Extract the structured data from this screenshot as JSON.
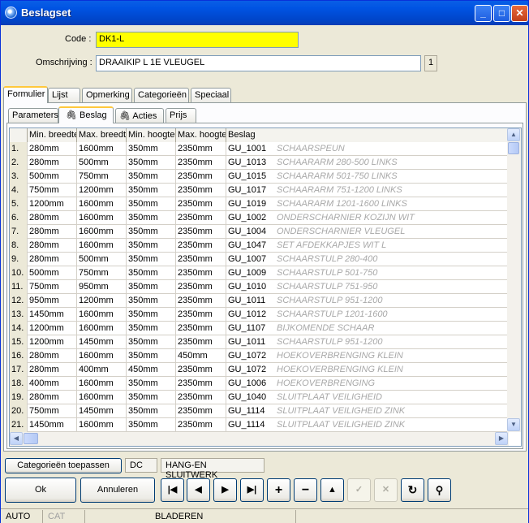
{
  "window": {
    "title": "Beslagset"
  },
  "form": {
    "code_label": "Code :",
    "code_value": "DK1-L",
    "omschrijving_label": "Omschrijving :",
    "omschrijving_value": "DRAAIKIP L 1E VLEUGEL",
    "page_indicator": "1"
  },
  "tabs_main": [
    "Formulier",
    "Lijst",
    "Opmerking",
    "Categorieën",
    "Speciaal"
  ],
  "tabs_sub": [
    "Parameters",
    "Beslag",
    "Acties",
    "Prijs"
  ],
  "grid": {
    "columns": [
      "Min. breedte",
      "Max. breedte",
      "Min. hoogte",
      "Max. hoogte",
      "Beslag"
    ],
    "rows": [
      {
        "n": "1.",
        "minb": "280mm",
        "maxb": "1600mm",
        "minh": "350mm",
        "maxh": "2350mm",
        "code": "GU_1001",
        "desc": "SCHAARSPEUN"
      },
      {
        "n": "2.",
        "minb": "280mm",
        "maxb": "500mm",
        "minh": "350mm",
        "maxh": "2350mm",
        "code": "GU_1013",
        "desc": "SCHAARARM 280-500 LINKS"
      },
      {
        "n": "3.",
        "minb": "500mm",
        "maxb": "750mm",
        "minh": "350mm",
        "maxh": "2350mm",
        "code": "GU_1015",
        "desc": "SCHAARARM 501-750 LINKS"
      },
      {
        "n": "4.",
        "minb": "750mm",
        "maxb": "1200mm",
        "minh": "350mm",
        "maxh": "2350mm",
        "code": "GU_1017",
        "desc": "SCHAARARM 751-1200 LINKS"
      },
      {
        "n": "5.",
        "minb": "1200mm",
        "maxb": "1600mm",
        "minh": "350mm",
        "maxh": "2350mm",
        "code": "GU_1019",
        "desc": "SCHAARARM 1201-1600 LINKS"
      },
      {
        "n": "6.",
        "minb": "280mm",
        "maxb": "1600mm",
        "minh": "350mm",
        "maxh": "2350mm",
        "code": "GU_1002",
        "desc": "ONDERSCHARNIER KOZIJN WIT"
      },
      {
        "n": "7.",
        "minb": "280mm",
        "maxb": "1600mm",
        "minh": "350mm",
        "maxh": "2350mm",
        "code": "GU_1004",
        "desc": "ONDERSCHARNIER VLEUGEL"
      },
      {
        "n": "8.",
        "minb": "280mm",
        "maxb": "1600mm",
        "minh": "350mm",
        "maxh": "2350mm",
        "code": "GU_1047",
        "desc": "SET AFDEKKAPJES WIT L"
      },
      {
        "n": "9.",
        "minb": "280mm",
        "maxb": "500mm",
        "minh": "350mm",
        "maxh": "2350mm",
        "code": "GU_1007",
        "desc": "SCHAARSTULP 280-400"
      },
      {
        "n": "10.",
        "minb": "500mm",
        "maxb": "750mm",
        "minh": "350mm",
        "maxh": "2350mm",
        "code": "GU_1009",
        "desc": "SCHAARSTULP 501-750"
      },
      {
        "n": "11.",
        "minb": "750mm",
        "maxb": "950mm",
        "minh": "350mm",
        "maxh": "2350mm",
        "code": "GU_1010",
        "desc": "SCHAARSTULP 751-950"
      },
      {
        "n": "12.",
        "minb": "950mm",
        "maxb": "1200mm",
        "minh": "350mm",
        "maxh": "2350mm",
        "code": "GU_1011",
        "desc": "SCHAARSTULP 951-1200"
      },
      {
        "n": "13.",
        "minb": "1450mm",
        "maxb": "1600mm",
        "minh": "350mm",
        "maxh": "2350mm",
        "code": "GU_1012",
        "desc": "SCHAARSTULP 1201-1600"
      },
      {
        "n": "14.",
        "minb": "1200mm",
        "maxb": "1600mm",
        "minh": "350mm",
        "maxh": "2350mm",
        "code": "GU_1107",
        "desc": "BIJKOMENDE SCHAAR"
      },
      {
        "n": "15.",
        "minb": "1200mm",
        "maxb": "1450mm",
        "minh": "350mm",
        "maxh": "2350mm",
        "code": "GU_1011",
        "desc": "SCHAARSTULP 951-1200"
      },
      {
        "n": "16.",
        "minb": "280mm",
        "maxb": "1600mm",
        "minh": "350mm",
        "maxh": "450mm",
        "code": "GU_1072",
        "desc": "HOEKOVERBRENGING KLEIN"
      },
      {
        "n": "17.",
        "minb": "280mm",
        "maxb": "400mm",
        "minh": "450mm",
        "maxh": "2350mm",
        "code": "GU_1072",
        "desc": "HOEKOVERBRENGING KLEIN"
      },
      {
        "n": "18.",
        "minb": "400mm",
        "maxb": "1600mm",
        "minh": "350mm",
        "maxh": "2350mm",
        "code": "GU_1006",
        "desc": "HOEKOVERBRENGING"
      },
      {
        "n": "19.",
        "minb": "280mm",
        "maxb": "1600mm",
        "minh": "350mm",
        "maxh": "2350mm",
        "code": "GU_1040",
        "desc": "SLUITPLAAT VEILIGHEID"
      },
      {
        "n": "20.",
        "minb": "750mm",
        "maxb": "1450mm",
        "minh": "350mm",
        "maxh": "2350mm",
        "code": "GU_1114",
        "desc": "SLUITPLAAT VEILIGHEID ZINK"
      },
      {
        "n": "21.",
        "minb": "1450mm",
        "maxb": "1600mm",
        "minh": "350mm",
        "maxh": "2350mm",
        "code": "GU_1114",
        "desc": "SLUITPLAAT VEILIGHEID ZINK"
      }
    ]
  },
  "categories": {
    "button_label": "Categorieën toepassen",
    "tag1": "DC",
    "tag2": "HANG-EN SLUITWERK"
  },
  "buttons": {
    "ok": "Ok",
    "cancel": "Annuleren"
  },
  "status": {
    "mode1": "AUTO",
    "mode2": "CAT",
    "mode3": "BLADEREN"
  }
}
